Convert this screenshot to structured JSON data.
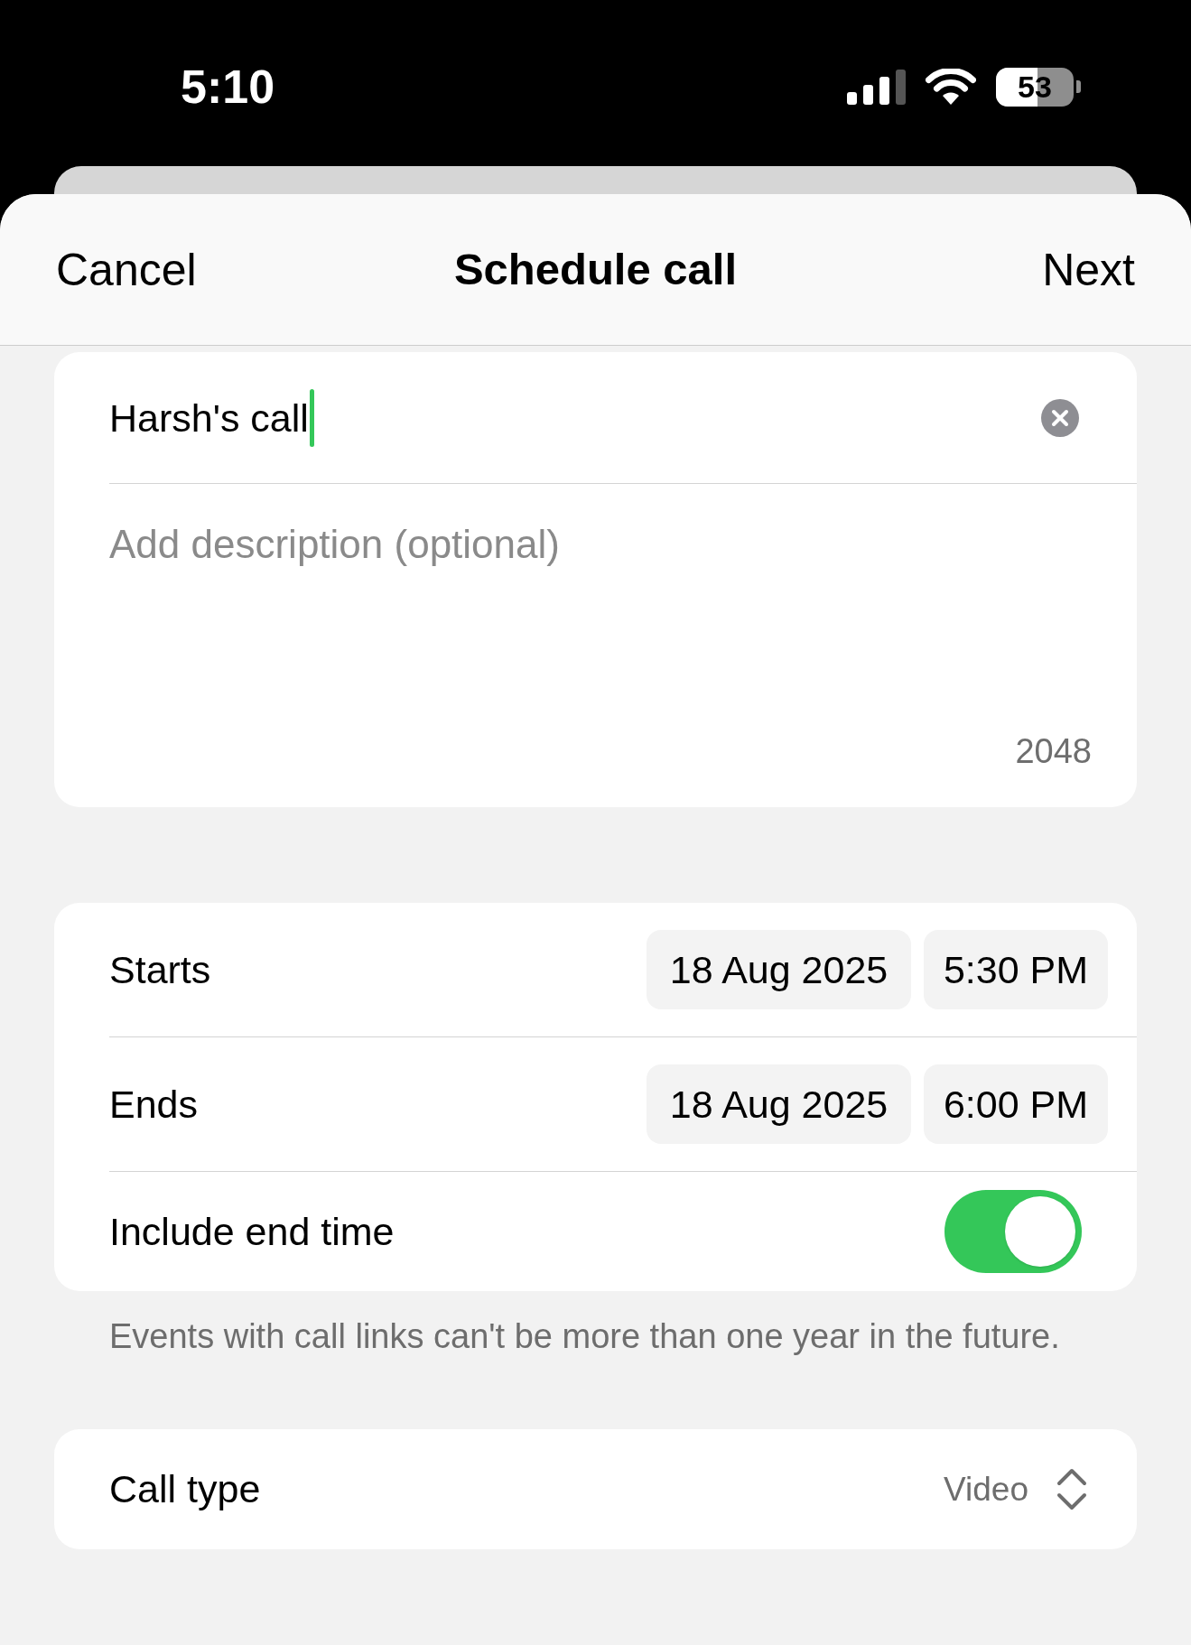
{
  "status_bar": {
    "time": "5:10",
    "battery": "53"
  },
  "header": {
    "cancel": "Cancel",
    "title": "Schedule call",
    "next": "Next"
  },
  "details": {
    "title_value": "Harsh's call",
    "focused": true,
    "description_placeholder": "Add description (optional)",
    "character_count": "2048"
  },
  "schedule": {
    "rows": [
      {
        "kind": "datetime",
        "label": "Starts",
        "date": "18 Aug 2025",
        "time": "5:30 PM"
      },
      {
        "kind": "datetime",
        "label": "Ends",
        "date": "18 Aug 2025",
        "time": "6:00 PM"
      },
      {
        "kind": "toggle",
        "label": "Include end time",
        "on": true
      }
    ],
    "note": "Events with call links can't be more than one year in the future."
  },
  "call_type": {
    "label": "Call type",
    "value": "Video"
  }
}
